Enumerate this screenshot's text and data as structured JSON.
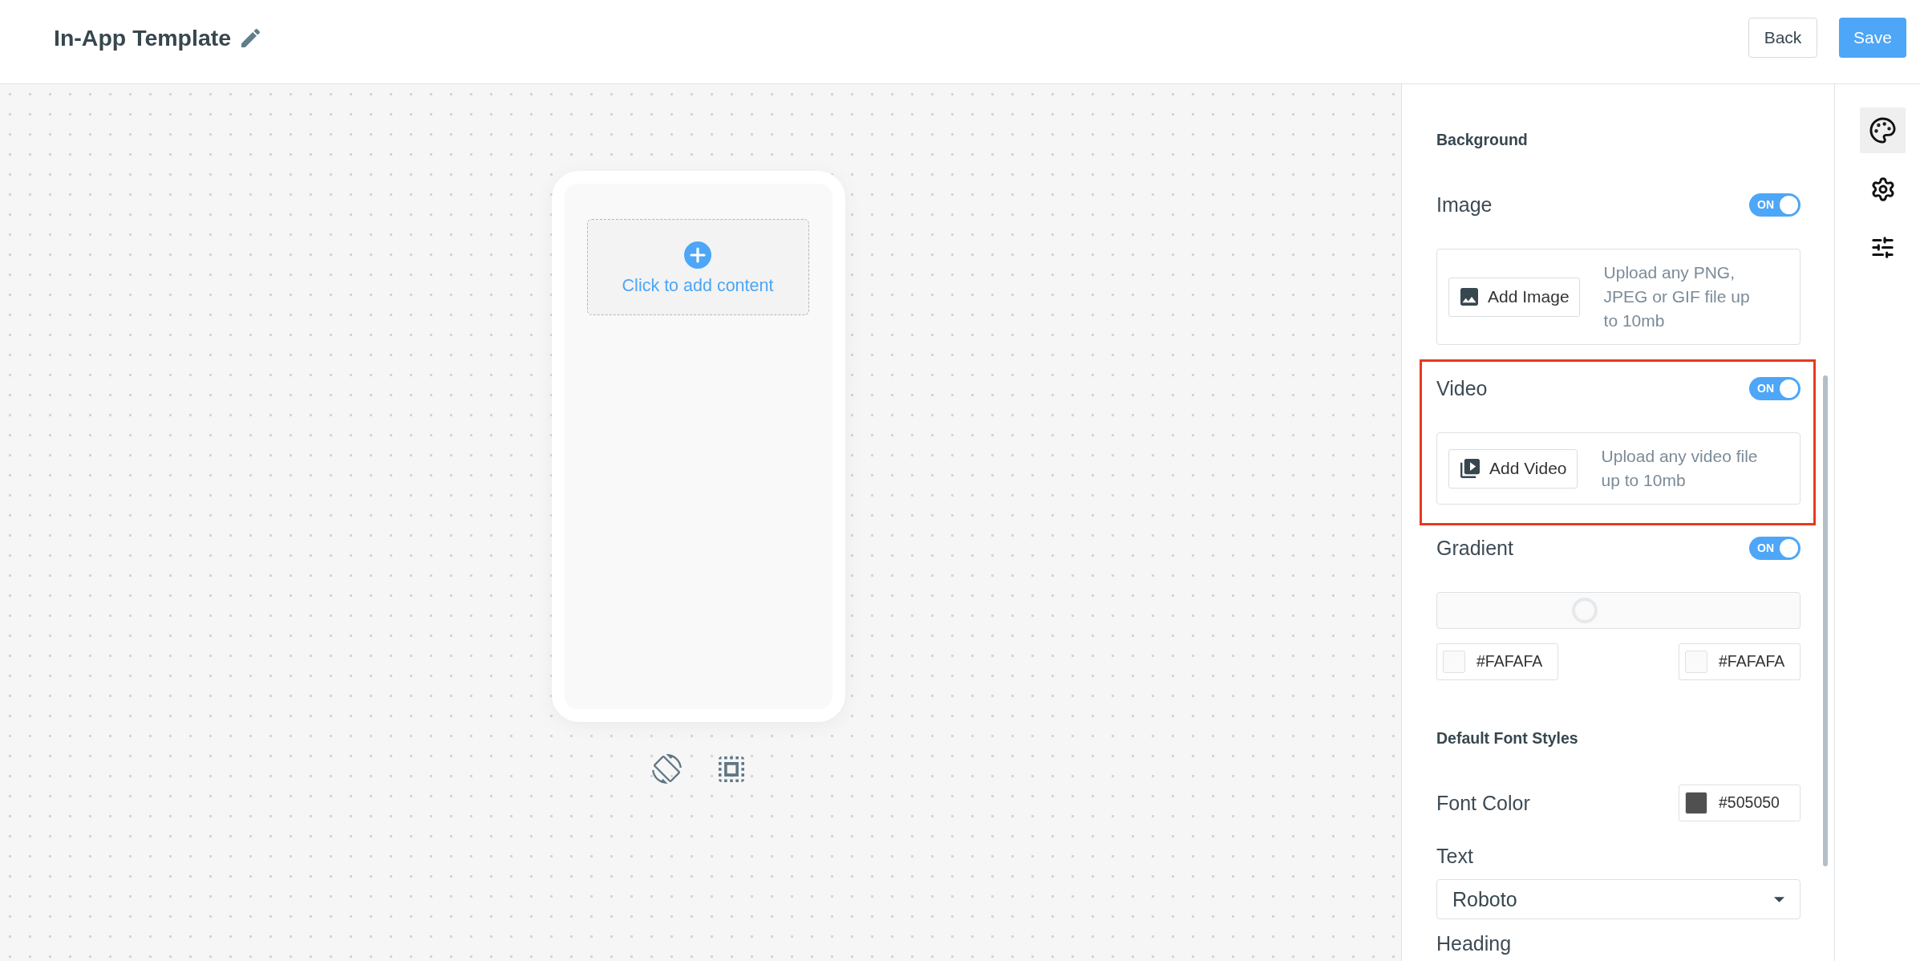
{
  "header": {
    "title": "In-App Template",
    "buttons": [
      {
        "label": "Back",
        "kind": "secondary"
      },
      {
        "label": "Save",
        "kind": "primary"
      }
    ]
  },
  "canvas": {
    "add_content": "Click to add content"
  },
  "background": {
    "title": "Background",
    "sections": [
      {
        "kind": "image",
        "label": "Image",
        "on": true,
        "toggle_text": "ON",
        "highlighted": false,
        "button": "Add Image",
        "hint": "Upload any PNG, JPEG or GIF file up to 10mb"
      },
      {
        "kind": "video",
        "label": "Video",
        "on": true,
        "toggle_text": "ON",
        "highlighted": true,
        "button": "Add Video",
        "hint": "Upload any video file up to 10mb"
      },
      {
        "kind": "gradient",
        "label": "Gradient",
        "on": true,
        "toggle_text": "ON",
        "highlighted": false,
        "level": 0.4,
        "stops": [
          {
            "value": "#FAFAFA",
            "color": "#fafafa"
          },
          {
            "value": "#FAFAFA",
            "color": "#fafafa"
          }
        ]
      }
    ]
  },
  "font_styles": {
    "title": "Default Font Styles",
    "font_color": {
      "label": "Font Color",
      "value": "#505050",
      "color": "#505050"
    },
    "text_font": {
      "label": "Text",
      "value": "Roboto"
    },
    "heading_font": {
      "label": "Heading"
    }
  },
  "tool_rail": [
    {
      "selected": true
    },
    {
      "selected": false
    },
    {
      "selected": false
    }
  ]
}
